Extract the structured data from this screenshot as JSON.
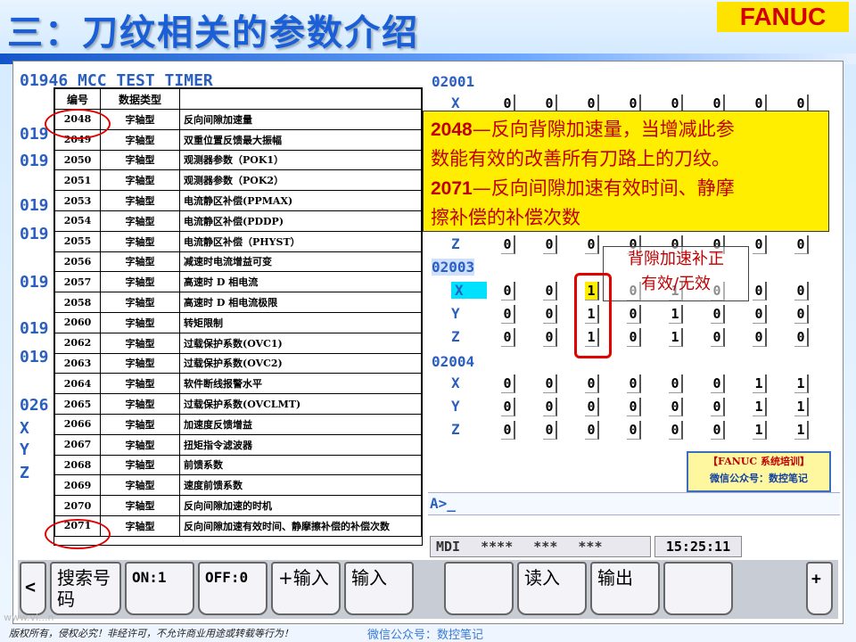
{
  "slide_title": "三：刀纹相关的参数介绍",
  "logo": "FANUC",
  "bg_left_text": {
    "header": "01946  MCC TEST TIMER",
    "rows": [
      "019",
      "019",
      "019",
      "019",
      "019",
      "019",
      "019",
      "026",
      "X",
      "Y",
      "Z"
    ]
  },
  "param_table": {
    "headers": [
      "编号",
      "数据类型",
      ""
    ],
    "rows": [
      [
        "2048",
        "字轴型",
        "反向间隙加速量"
      ],
      [
        "2049",
        "字轴型",
        "双重位置反馈最大振幅"
      ],
      [
        "2050",
        "字轴型",
        "观测器参数（POK1）"
      ],
      [
        "2051",
        "字轴型",
        "观测器参数（POK2）"
      ],
      [
        "2053",
        "字轴型",
        "电流静区补偿(PPMAX)"
      ],
      [
        "2054",
        "字轴型",
        "电流静区补偿(PDDP)"
      ],
      [
        "2055",
        "字轴型",
        "电流静区补偿（PHYST）"
      ],
      [
        "2056",
        "字轴型",
        "减速时电流增益可变"
      ],
      [
        "2057",
        "字轴型",
        "高速时 D 相电流"
      ],
      [
        "2058",
        "字轴型",
        "高速时 D 相电流极限"
      ],
      [
        "2060",
        "字轴型",
        "转矩限制"
      ],
      [
        "2062",
        "字轴型",
        "过载保护系数(OVC1)"
      ],
      [
        "2063",
        "字轴型",
        "过载保护系数(OVC2)"
      ],
      [
        "2064",
        "字轴型",
        "软件断线报警水平"
      ],
      [
        "2065",
        "字轴型",
        "过载保护系数(OVCLMT)"
      ],
      [
        "2066",
        "字轴型",
        "加速度反馈增益"
      ],
      [
        "2067",
        "字轴型",
        "扭矩指令滤波器"
      ],
      [
        "2068",
        "字轴型",
        "前馈系数"
      ],
      [
        "2069",
        "字轴型",
        "速度前馈系数"
      ],
      [
        "2070",
        "字轴型",
        "反向间隙加速的时机"
      ],
      [
        "2071",
        "字轴型",
        "反向间隙加速有效时间、静摩擦补偿的补偿次数"
      ]
    ]
  },
  "param_groups": [
    {
      "id": "02001",
      "axes": [
        {
          "axis": "X",
          "values": [
            "0",
            "0",
            "0",
            "0",
            "0",
            "0",
            "0",
            "0"
          ]
        }
      ]
    },
    {
      "id": "",
      "axes": [
        {
          "axis": "Z",
          "values": [
            "0",
            "0",
            "0",
            "0",
            "0",
            "0",
            "0",
            "0"
          ]
        }
      ]
    },
    {
      "id": "02003",
      "axes": [
        {
          "axis": "X",
          "values": [
            "0",
            "0",
            "1",
            "0",
            "1",
            "0",
            "0",
            "0"
          ]
        },
        {
          "axis": "Y",
          "values": [
            "0",
            "0",
            "1",
            "0",
            "1",
            "0",
            "0",
            "0"
          ]
        },
        {
          "axis": "Z",
          "values": [
            "0",
            "0",
            "1",
            "0",
            "1",
            "0",
            "0",
            "0"
          ]
        }
      ]
    },
    {
      "id": "02004",
      "axes": [
        {
          "axis": "X",
          "values": [
            "0",
            "0",
            "0",
            "0",
            "0",
            "0",
            "1",
            "1"
          ]
        },
        {
          "axis": "Y",
          "values": [
            "0",
            "0",
            "0",
            "0",
            "0",
            "0",
            "1",
            "1"
          ]
        },
        {
          "axis": "Z",
          "values": [
            "0",
            "0",
            "0",
            "0",
            "0",
            "0",
            "1",
            "1"
          ]
        }
      ]
    }
  ],
  "note_yellow": {
    "line1_num": "2048",
    "line1_text": "—反向背隙加速量，当增减此参",
    "line2": "数能有效的改善所有刀路上的刀纹。",
    "line3_num": "2071",
    "line3_text": "—反向间隙加速有效时间、静摩",
    "line4": "擦补偿的补偿次数"
  },
  "note_white": {
    "line1": "背隙加速补正",
    "line2": "有效/无效"
  },
  "training_box": {
    "line1": "【FANUC 系统培训】",
    "line2": "微信公众号：数控笔记"
  },
  "cmd_prompt": "A>_",
  "status": {
    "mode": "MDI",
    "stars1": "****",
    "stars2": "***",
    "stars3": "***",
    "time": "15:25:11"
  },
  "softkeys": [
    "<",
    "搜索号码",
    "ON:1",
    "OFF:0",
    "+输入",
    "输入",
    "",
    "读入",
    "输出",
    "",
    "+"
  ],
  "footer": {
    "copyright": "版权所有，侵权必究！非经许可，不允许商业用途或转载等行为！",
    "wechat": "微信公众号：数控笔记",
    "watermark": "www.vl...n"
  }
}
